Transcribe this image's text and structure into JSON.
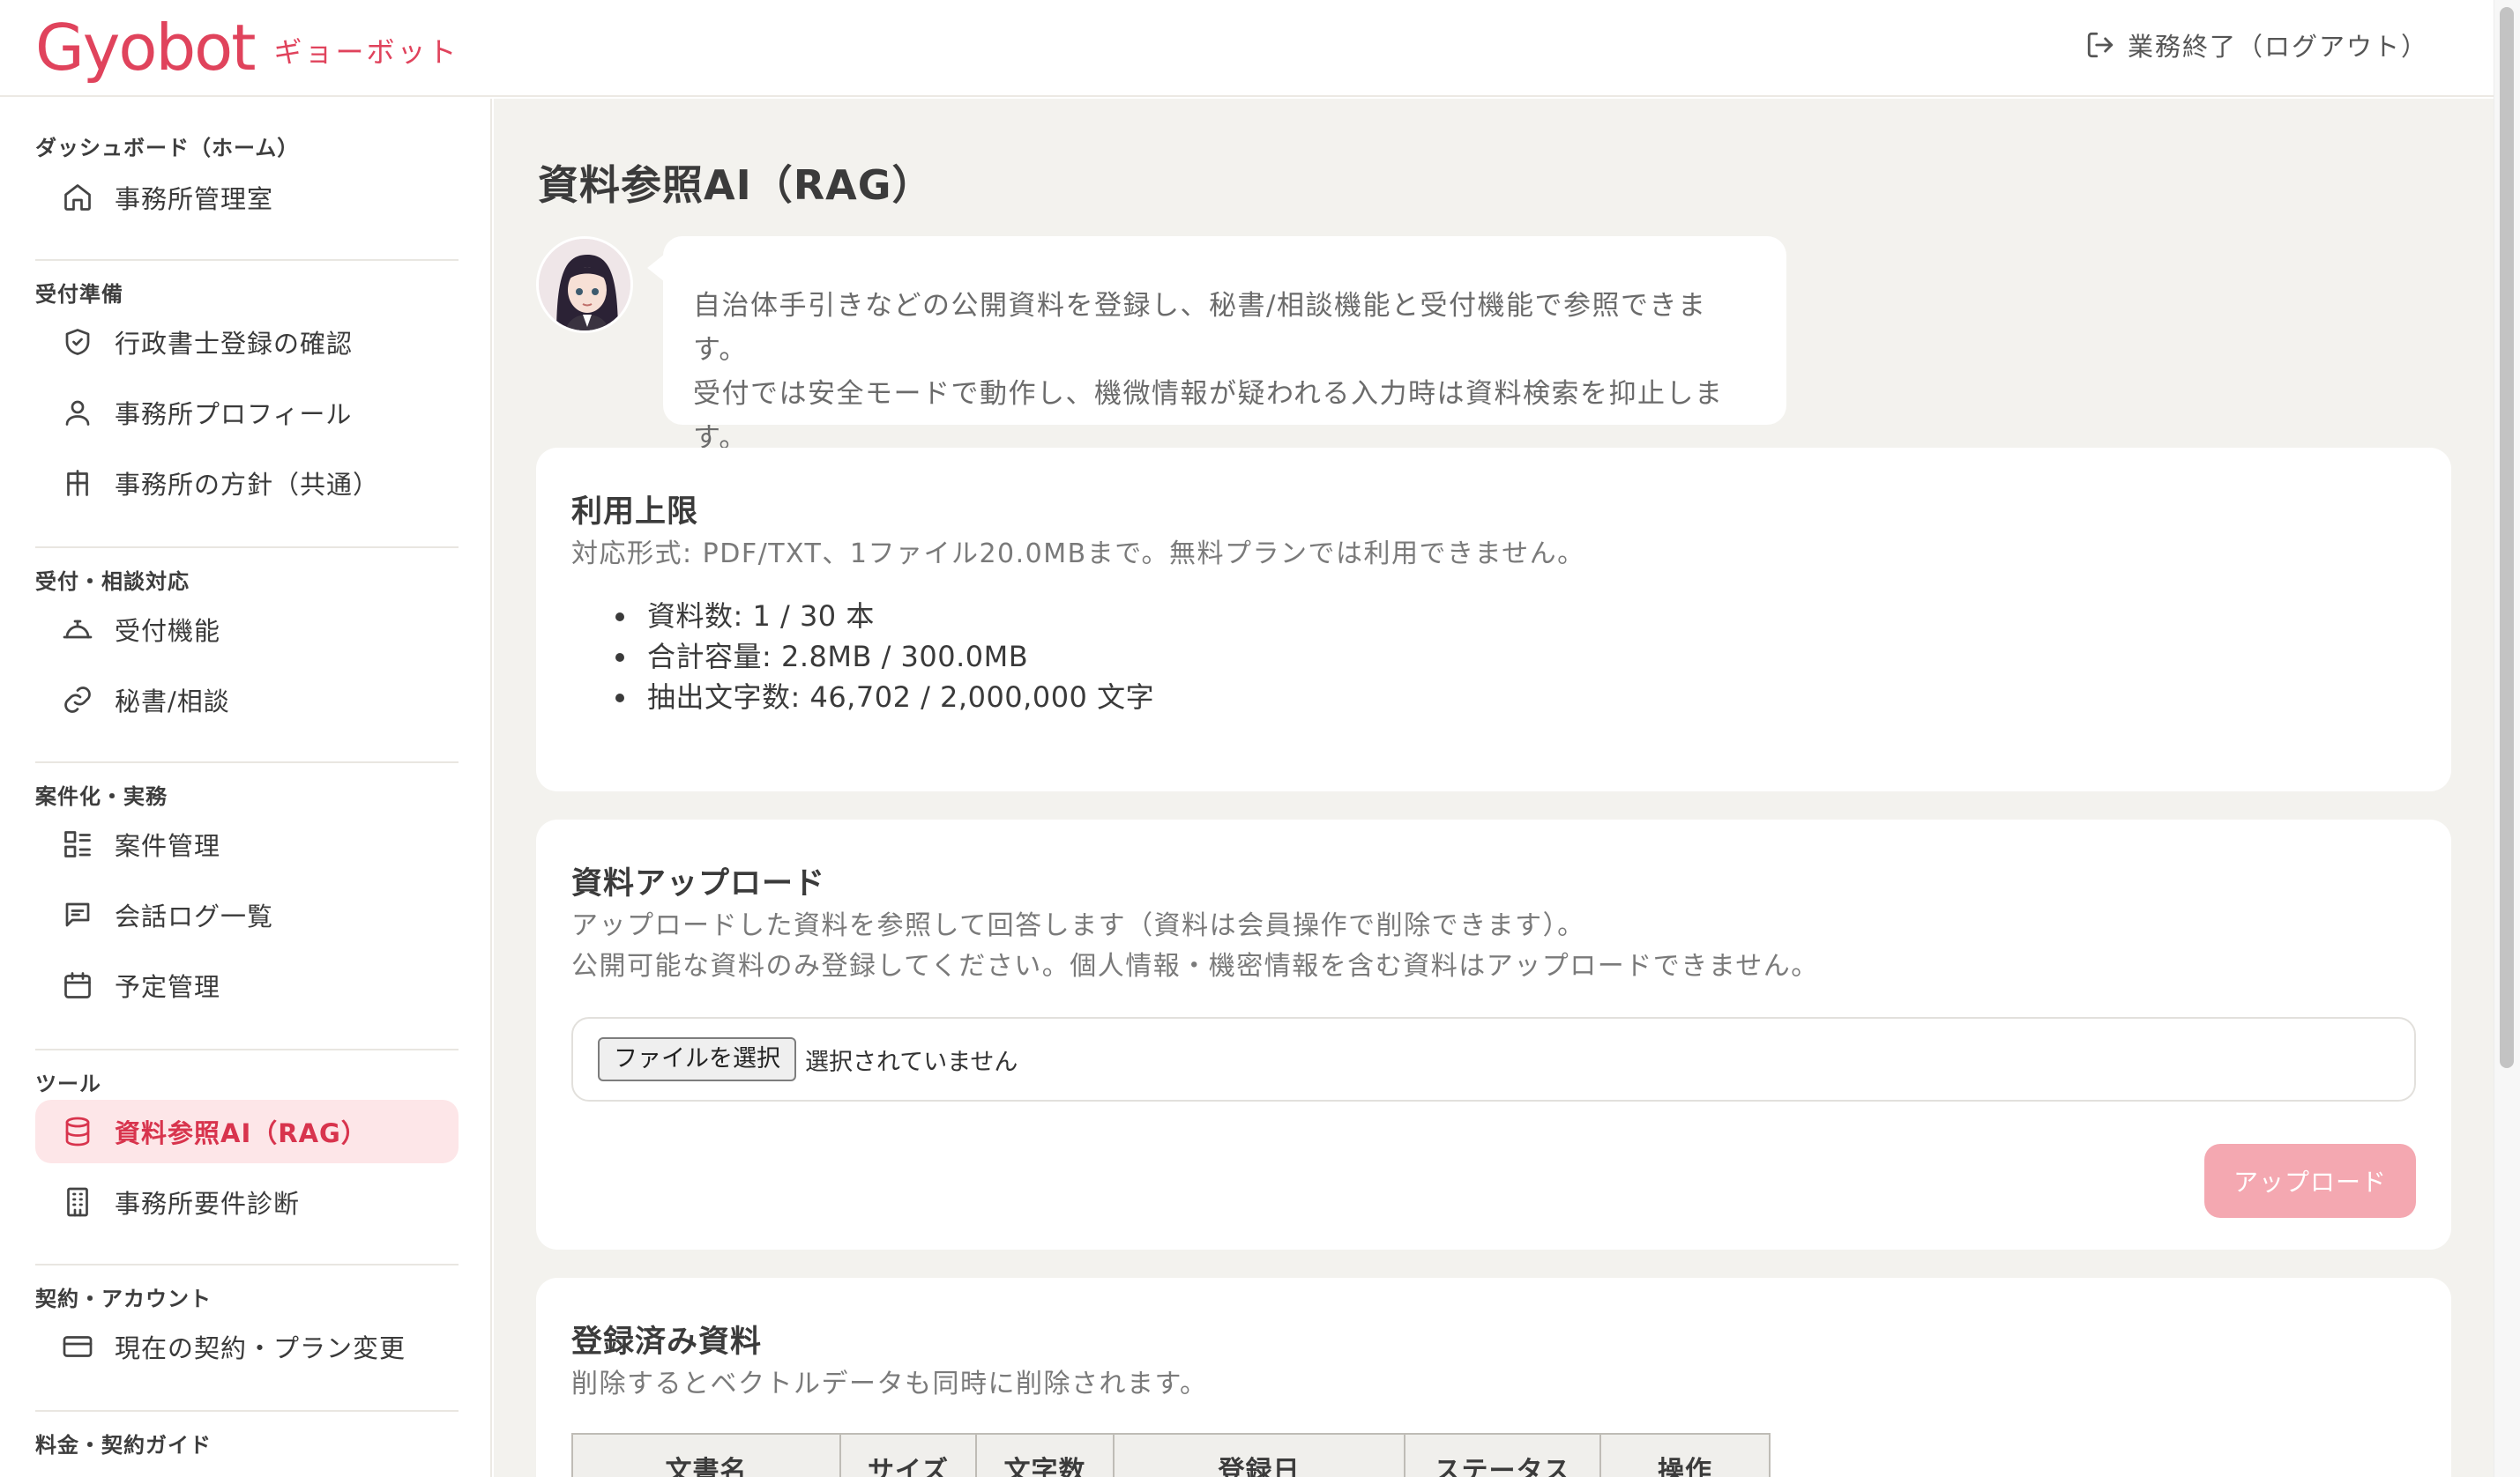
{
  "header": {
    "logo": "Gyobot",
    "logo_kana": "ギョーボット",
    "logout_label": "業務終了（ログアウト）"
  },
  "sidebar": {
    "sections": [
      {
        "title": "ダッシュボード（ホーム）",
        "items": [
          {
            "label": "事務所管理室",
            "icon": "home-icon"
          }
        ]
      },
      {
        "title": "受付準備",
        "items": [
          {
            "label": "行政書士登録の確認",
            "icon": "shield-check-icon"
          },
          {
            "label": "事務所プロフィール",
            "icon": "user-icon"
          },
          {
            "label": "事務所の方針（共通）",
            "icon": "signpost-icon"
          }
        ]
      },
      {
        "title": "受付・相談対応",
        "items": [
          {
            "label": "受付機能",
            "icon": "concierge-icon"
          },
          {
            "label": "秘書/相談",
            "icon": "link-icon"
          }
        ]
      },
      {
        "title": "案件化・実務",
        "items": [
          {
            "label": "案件管理",
            "icon": "list-grid-icon"
          },
          {
            "label": "会話ログ一覧",
            "icon": "message-icon"
          },
          {
            "label": "予定管理",
            "icon": "calendar-icon"
          }
        ]
      },
      {
        "title": "ツール",
        "items": [
          {
            "label": "資料参照AI（RAG）",
            "icon": "database-icon",
            "active": true
          },
          {
            "label": "事務所要件診断",
            "icon": "building-icon"
          }
        ]
      },
      {
        "title": "契約・アカウント",
        "items": [
          {
            "label": "現在の契約・プラン変更",
            "icon": "credit-card-icon"
          }
        ]
      },
      {
        "title": "料金・契約ガイド",
        "items": []
      }
    ]
  },
  "main": {
    "page_title": "資料参照AI（RAG）",
    "intro": [
      "自治体手引きなどの公開資料を登録し、秘書/相談機能と受付機能で参照できます。",
      "受付では安全モードで動作し、機微情報が疑われる入力時は資料検索を抑止します。"
    ],
    "limits": {
      "title": "利用上限",
      "desc": "対応形式: PDF/TXT、1ファイル20.0MBまで。無料プランでは利用できません。",
      "items": [
        "資料数: 1 / 30 本",
        "合計容量: 2.8MB / 300.0MB",
        "抽出文字数: 46,702 / 2,000,000 文字"
      ]
    },
    "upload": {
      "title": "資料アップロード",
      "desc1": "アップロードした資料を参照して回答します（資料は会員操作で削除できます）。",
      "desc2": "公開可能な資料のみ登録してください。個人情報・機密情報を含む資料はアップロードできません。",
      "file_button": "ファイルを選択",
      "file_status": "選択されていません",
      "submit": "アップロード"
    },
    "docs": {
      "title": "登録済み資料",
      "desc": "削除するとベクトルデータも同時に削除されます。",
      "columns": [
        "文書名",
        "サイズ",
        "文字数",
        "登録日",
        "ステータス",
        "操作"
      ]
    }
  },
  "colors": {
    "accent": "#e0435c",
    "active_bg": "#fde6e8",
    "upload_disabled": "#f4a8b1",
    "main_bg": "#f3f2ee"
  }
}
